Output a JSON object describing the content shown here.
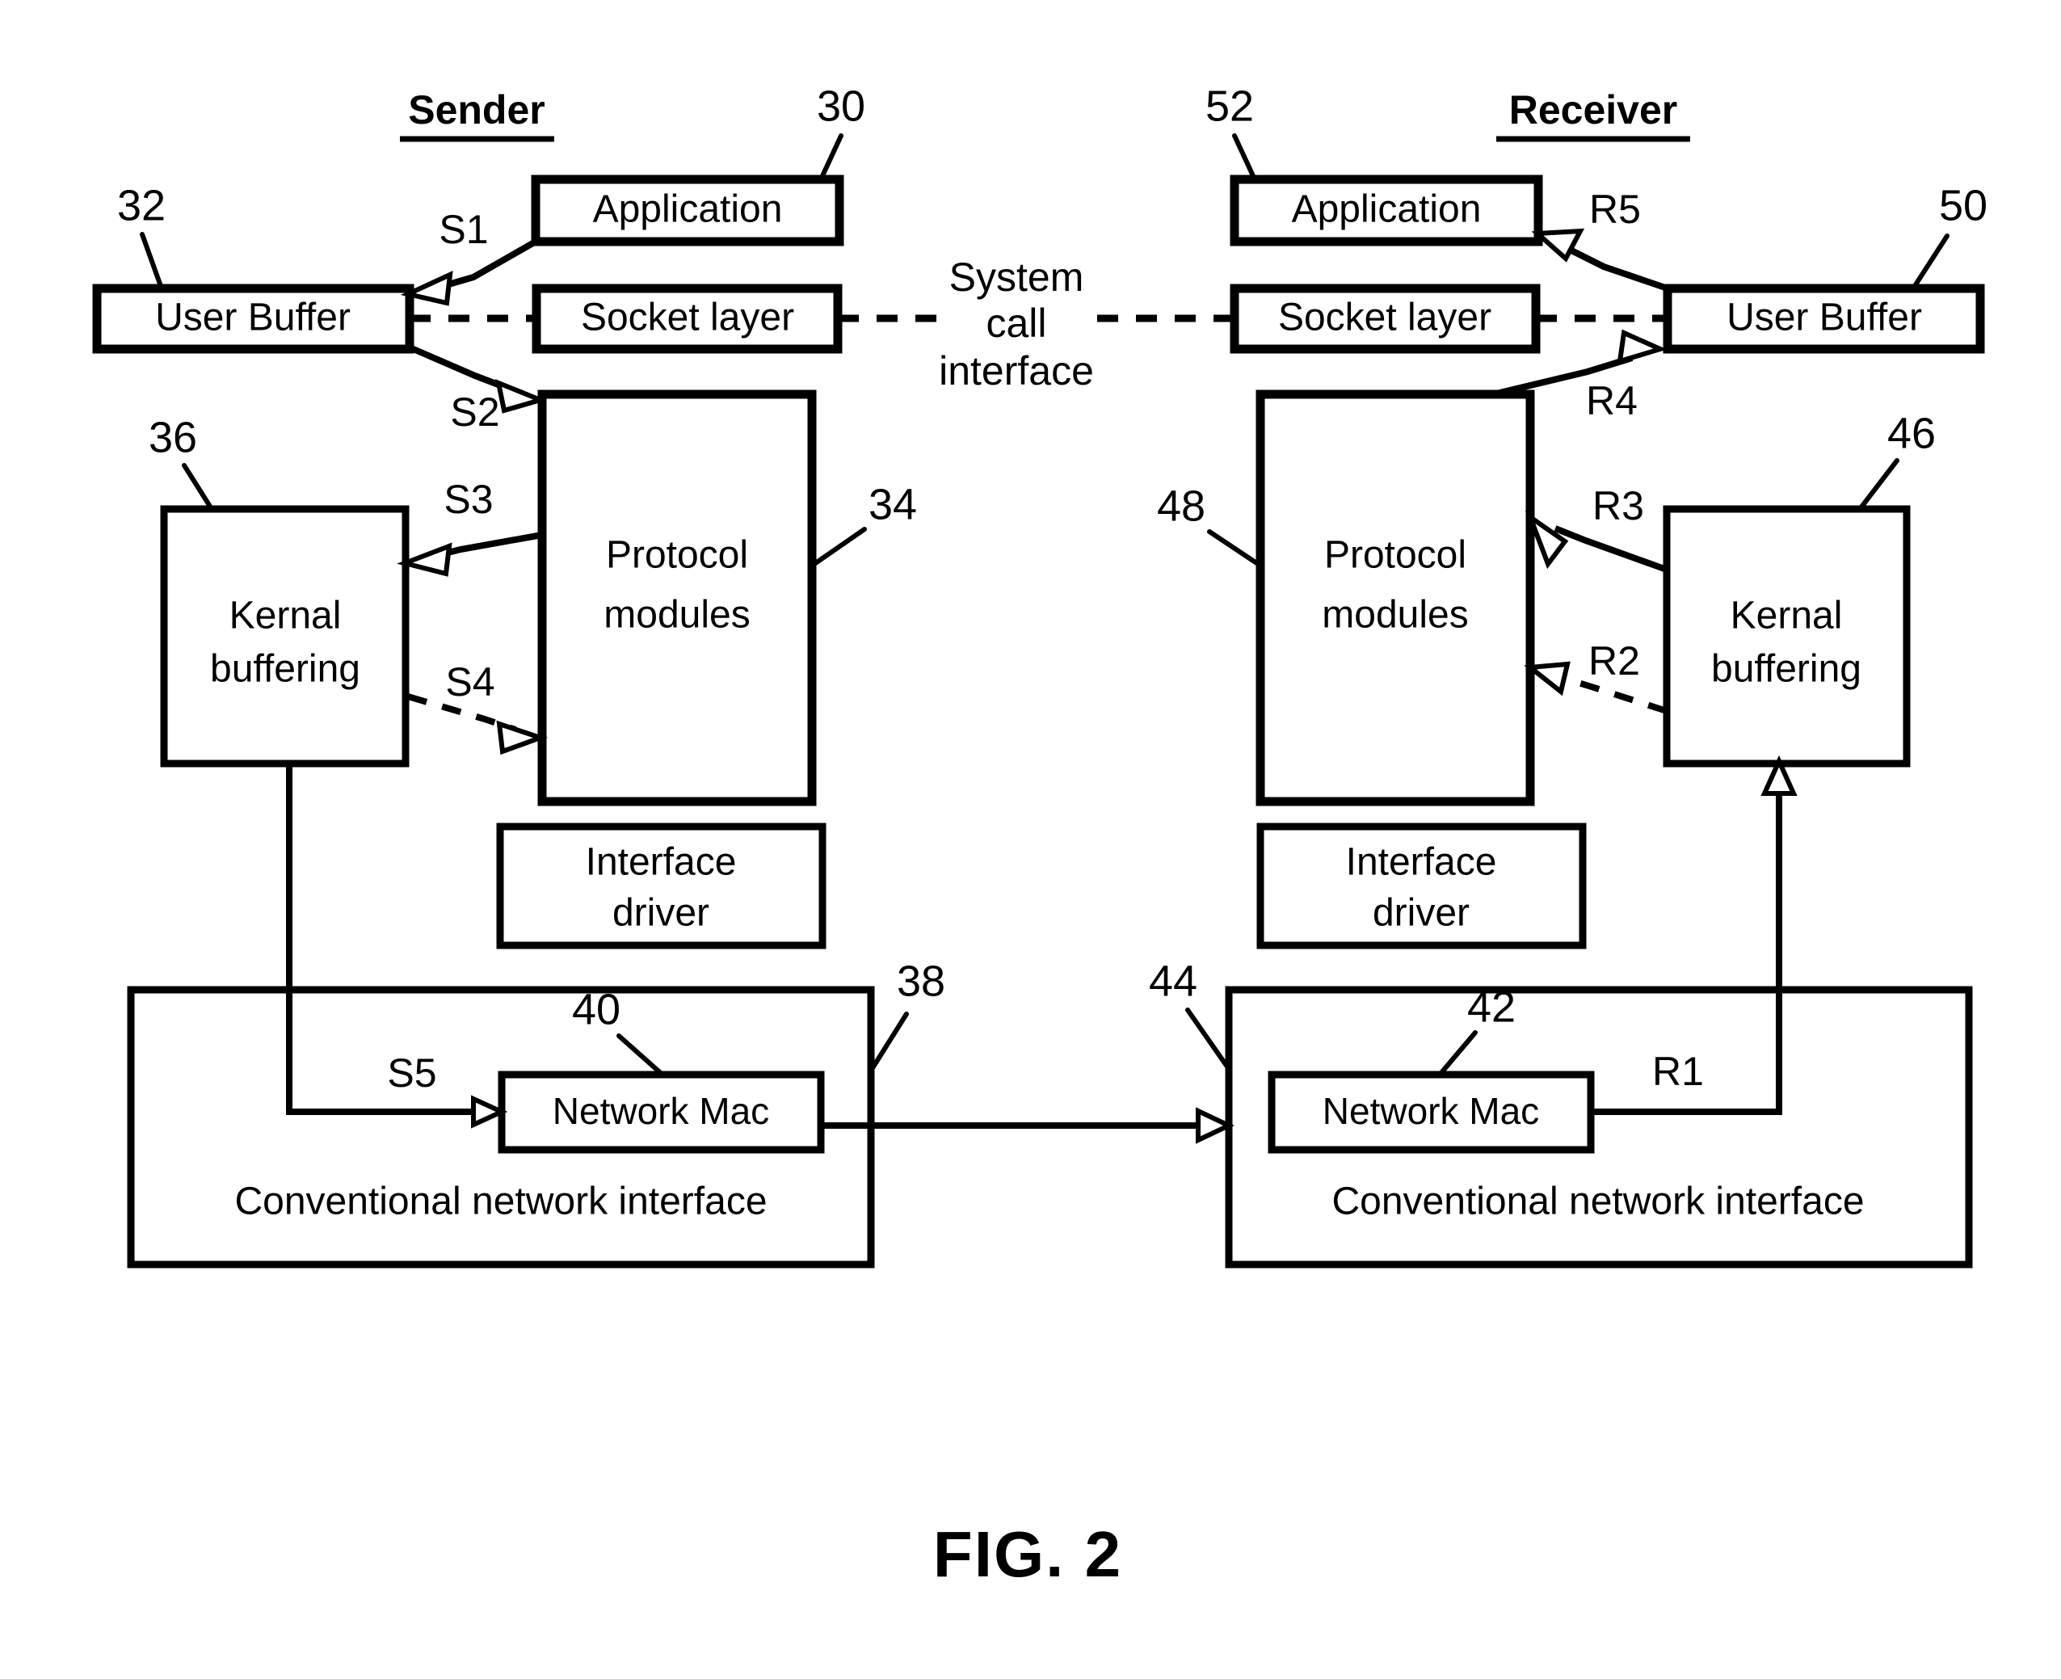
{
  "figure": {
    "caption": "FIG. 2",
    "headings": {
      "sender": "Sender",
      "receiver": "Receiver"
    },
    "system_call_note": {
      "line1": "System",
      "line2": "call",
      "line3": "interface"
    }
  },
  "sender": {
    "application": {
      "label": "Application",
      "ref": "30"
    },
    "user_buffer": {
      "label": "User Buffer",
      "ref": "32"
    },
    "socket_layer": {
      "label": "Socket layer"
    },
    "protocol_modules": {
      "label_line1": "Protocol",
      "label_line2": "modules",
      "ref": "34"
    },
    "kernal_buffering": {
      "label_line1": "Kernal",
      "label_line2": "buffering",
      "ref": "36"
    },
    "interface_driver": {
      "label_line1": "Interface",
      "label_line2": "driver"
    },
    "network_interface": {
      "label": "Conventional network interface",
      "ref": "38"
    },
    "network_mac": {
      "label": "Network Mac",
      "ref": "40"
    },
    "steps": [
      {
        "id": "S1",
        "label": "S1"
      },
      {
        "id": "S2",
        "label": "S2"
      },
      {
        "id": "S3",
        "label": "S3"
      },
      {
        "id": "S4",
        "label": "S4"
      },
      {
        "id": "S5",
        "label": "S5"
      }
    ]
  },
  "receiver": {
    "application": {
      "label": "Application",
      "ref": "52"
    },
    "user_buffer": {
      "label": "User Buffer",
      "ref": "50"
    },
    "socket_layer": {
      "label": "Socket layer"
    },
    "protocol_modules": {
      "label_line1": "Protocol",
      "label_line2": "modules",
      "ref": "48"
    },
    "kernal_buffering": {
      "label_line1": "Kernal",
      "label_line2": "buffering",
      "ref": "46"
    },
    "interface_driver": {
      "label_line1": "Interface",
      "label_line2": "driver"
    },
    "network_interface": {
      "label": "Conventional network interface",
      "ref": "44"
    },
    "network_mac": {
      "label": "Network Mac",
      "ref": "42"
    },
    "steps": [
      {
        "id": "R1",
        "label": "R1"
      },
      {
        "id": "R2",
        "label": "R2"
      },
      {
        "id": "R3",
        "label": "R3"
      },
      {
        "id": "R4",
        "label": "R4"
      },
      {
        "id": "R5",
        "label": "R5"
      }
    ]
  },
  "colors": {
    "ink": "#000000",
    "paper": "#ffffff"
  }
}
